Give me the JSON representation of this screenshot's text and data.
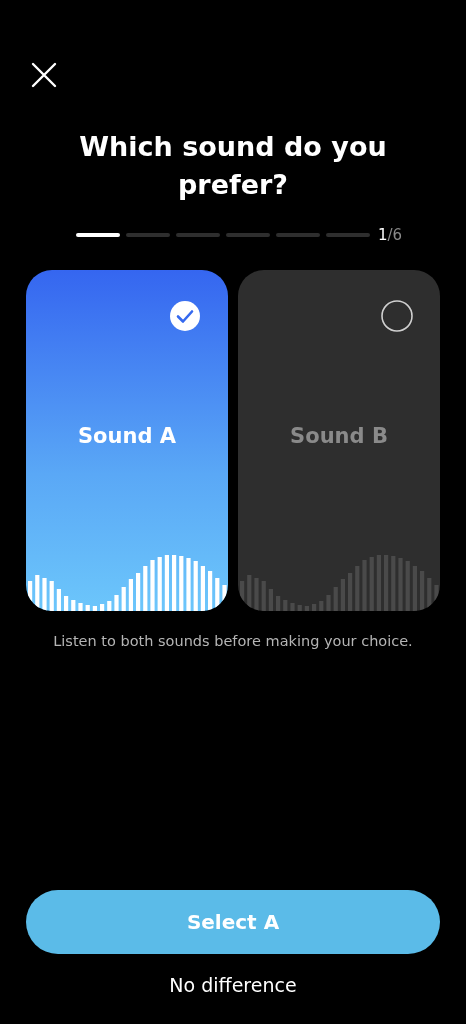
{
  "title": "Which sound do you prefer?",
  "progress": {
    "steps": [
      {
        "done": true
      },
      {
        "done": false
      },
      {
        "done": false
      },
      {
        "done": false
      },
      {
        "done": false
      },
      {
        "done": false
      }
    ],
    "current": "1",
    "total": "/6"
  },
  "options": [
    {
      "label": "Sound A",
      "selected": true
    },
    {
      "label": "Sound B",
      "selected": false
    }
  ],
  "hint": "Listen to both sounds before making your choice.",
  "primary_button": "Select A",
  "secondary_button": "No difference"
}
